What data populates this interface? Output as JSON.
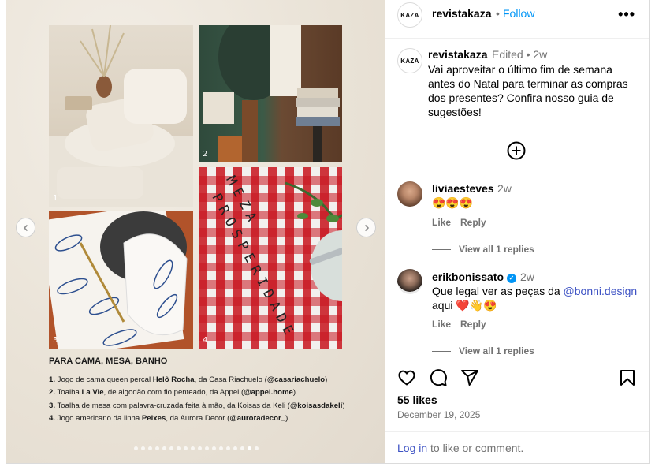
{
  "post": {
    "account": "revistakaza",
    "avatar_label": "KAZA",
    "follow_separator": "•",
    "follow_label": "Follow",
    "more_label": "•••",
    "caption_meta": "Edited  •  2w",
    "caption_text": "Vai aproveitar o último fim de semana antes do Natal para terminar as compras dos presentes? Confira nosso guia de sugestões!"
  },
  "media": {
    "photo_numbers": [
      "1",
      "2",
      "3",
      "4"
    ],
    "napkin_text_1": "PROSPERIDADE",
    "napkin_text_2": "MEZA",
    "heading": "PARA CAMA, MESA, BANHO",
    "items": [
      {
        "num": "1.",
        "pre": " Jogo de cama queen percal ",
        "bold": "Helô Rocha",
        "mid": ", da Casa Riachuelo (",
        "handle": "@casariachuelo",
        "end": ")"
      },
      {
        "num": "2.",
        "pre": " Toalha ",
        "bold": "La Vie",
        "mid": ", de algodão com fio penteado, da Appel (",
        "handle": "@appel.home",
        "end": ")"
      },
      {
        "num": "3.",
        "pre": " Toalha de mesa com palavra-cruzada feita à mão, da Koisas da Keli (",
        "bold": "",
        "mid": "",
        "handle": "@koisasdakeli",
        "end": ")"
      },
      {
        "num": "4.",
        "pre": " Jogo americano da linha ",
        "bold": "Peixes",
        "mid": ", da Aurora Decor (",
        "handle": "@auroradecor_",
        "end": ")"
      }
    ],
    "dot_count": 18,
    "active_dot": 16
  },
  "comments": [
    {
      "user": "liviaesteves",
      "time": "2w",
      "text": "😍😍😍",
      "like": "Like",
      "reply": "Reply",
      "replies": "View all 1 replies"
    },
    {
      "user": "erikbonissato",
      "verified": "✓",
      "time": "2w",
      "text_pre": "Que legal ver as peças da ",
      "mention": "@bonni.design",
      "text_post": "aqui ❤️👋😍",
      "like": "Like",
      "reply": "Reply",
      "replies": "View all 1 replies"
    }
  ],
  "footer": {
    "likes": "55 likes",
    "date": "December 19, 2025",
    "login_link": "Log in",
    "login_rest": " to like or comment."
  }
}
